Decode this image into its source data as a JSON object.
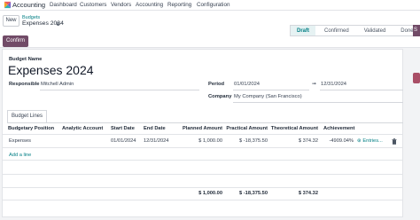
{
  "navbar": {
    "app_name": "Accounting",
    "menu": [
      "Dashboard",
      "Customers",
      "Vendors",
      "Accounting",
      "Reporting",
      "Configuration"
    ]
  },
  "control_panel": {
    "new_label": "New",
    "breadcrumb_parent": "Budgets",
    "breadcrumb_current": "Expenses 2024",
    "gear_icon": "⚙",
    "confirm_label": "Confirm",
    "stages": [
      "Draft",
      "Confirmed",
      "Validated",
      "Done"
    ],
    "active_stage": "Draft",
    "side_label": "S"
  },
  "form": {
    "name_label": "Budget Name",
    "name": "Expenses 2024",
    "responsible_label": "Responsible",
    "responsible": "Mitchell Admin",
    "period_label": "Period",
    "period_start": "01/01/2024",
    "period_arrow": "➞",
    "period_end": "12/31/2024",
    "company_label": "Company",
    "company": "My Company (San Francisco)"
  },
  "tabs": [
    "Budget Lines"
  ],
  "table": {
    "headers": [
      "Budgetary Position",
      "Analytic Account",
      "Start Date",
      "End Date",
      "Planned Amount",
      "Practical Amount",
      "Theoretical Amount",
      "Achievement"
    ],
    "rows": [
      {
        "position": "Expenses",
        "analytic": "",
        "start": "01/01/2024",
        "end": "12/31/2024",
        "planned": "$ 1,000.00",
        "practical": "$ -18,375.50",
        "theoretical": "$ 374.32",
        "achievement": "-4909.04%",
        "entries_label": "Entries...",
        "entries_icon": "⊛"
      }
    ],
    "add_line": "Add a line",
    "totals": {
      "planned": "$ 1,000.00",
      "practical": "$ -18,375.50",
      "theoretical": "$ 374.32"
    }
  },
  "colors": {
    "brand": "#714b67",
    "link": "#017e84"
  }
}
